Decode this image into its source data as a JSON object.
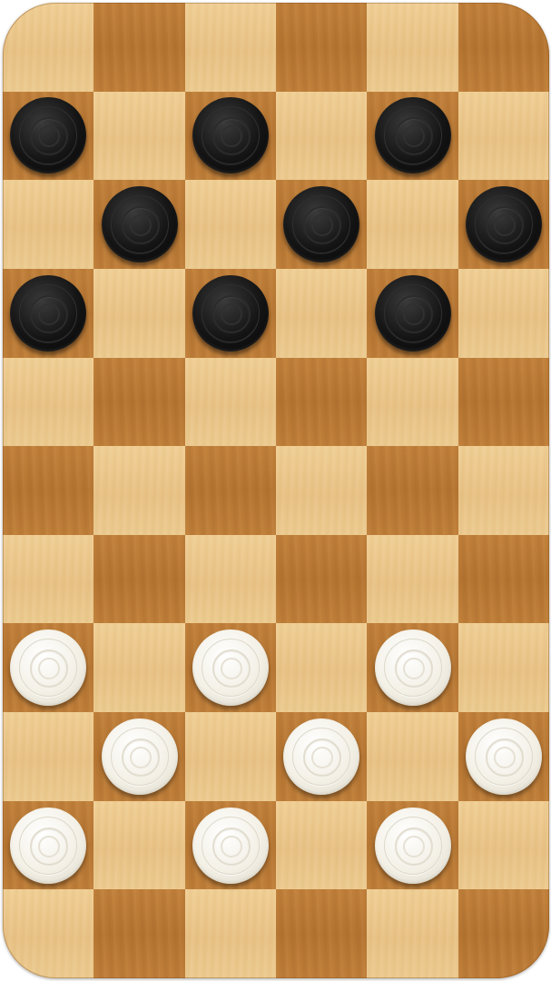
{
  "board": {
    "columns": 6,
    "rows": 11,
    "top_left_square": "light",
    "colors": {
      "light_square": "#ecc98c",
      "dark_square": "#bb7a36",
      "black_piece": "#111111",
      "white_piece": "#f4f1e8"
    }
  },
  "pieces": [
    {
      "color": "black",
      "row": 1,
      "col": 0
    },
    {
      "color": "black",
      "row": 1,
      "col": 2
    },
    {
      "color": "black",
      "row": 1,
      "col": 4
    },
    {
      "color": "black",
      "row": 2,
      "col": 1
    },
    {
      "color": "black",
      "row": 2,
      "col": 3
    },
    {
      "color": "black",
      "row": 2,
      "col": 5
    },
    {
      "color": "black",
      "row": 3,
      "col": 0
    },
    {
      "color": "black",
      "row": 3,
      "col": 2
    },
    {
      "color": "black",
      "row": 3,
      "col": 4
    },
    {
      "color": "white",
      "row": 7,
      "col": 0
    },
    {
      "color": "white",
      "row": 7,
      "col": 2
    },
    {
      "color": "white",
      "row": 7,
      "col": 4
    },
    {
      "color": "white",
      "row": 8,
      "col": 1
    },
    {
      "color": "white",
      "row": 8,
      "col": 3
    },
    {
      "color": "white",
      "row": 8,
      "col": 5
    },
    {
      "color": "white",
      "row": 9,
      "col": 0
    },
    {
      "color": "white",
      "row": 9,
      "col": 2
    },
    {
      "color": "white",
      "row": 9,
      "col": 4
    }
  ]
}
